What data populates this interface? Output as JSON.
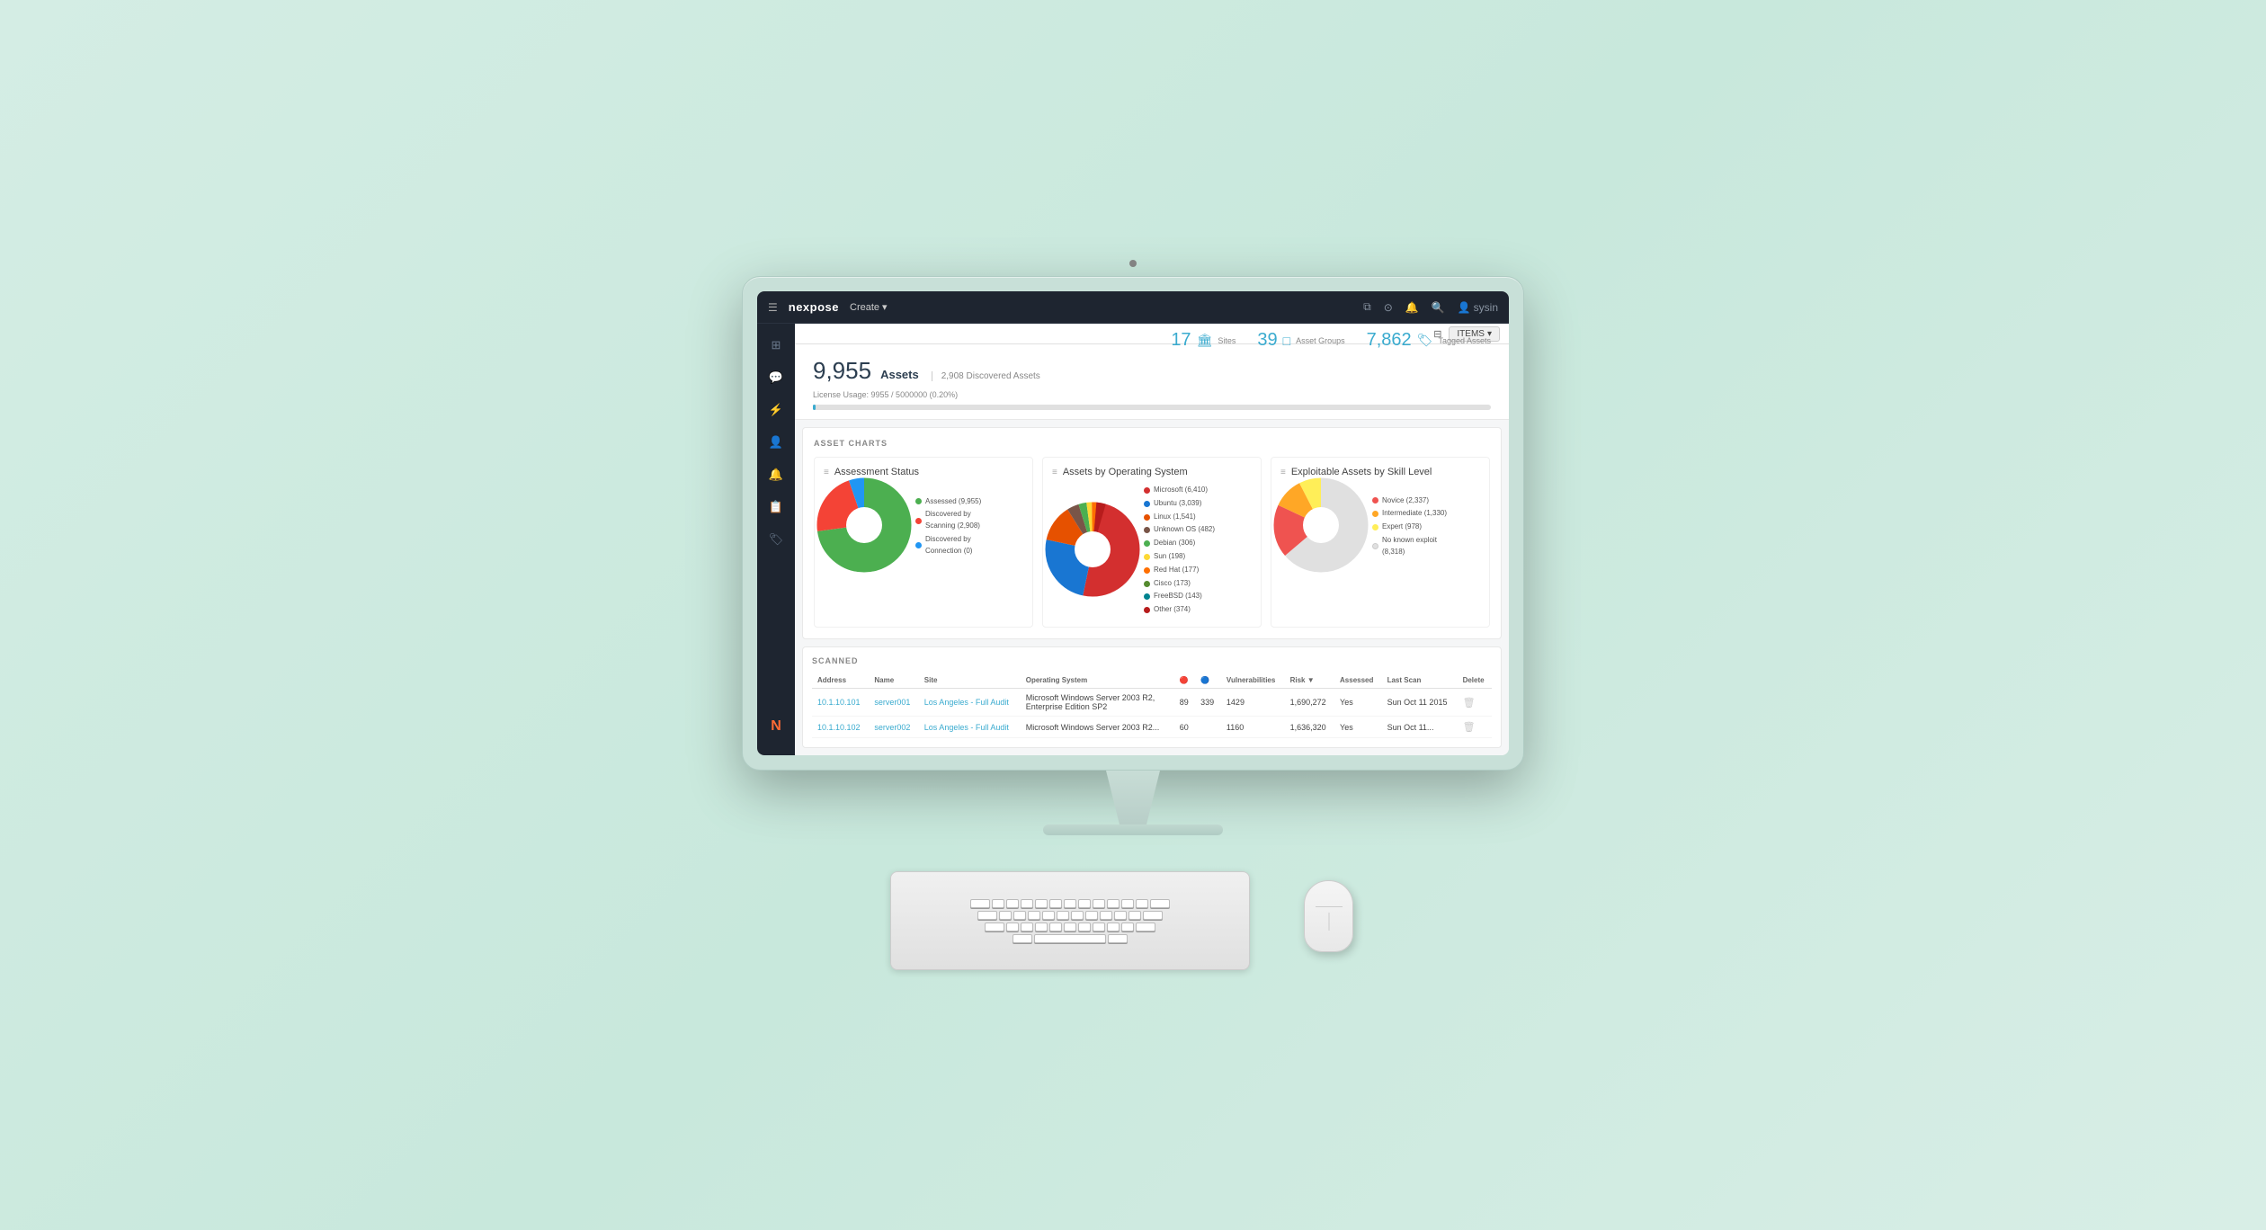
{
  "app": {
    "name": "nexpose",
    "create_label": "Create",
    "user": "sysin"
  },
  "toolbar": {
    "items_label": "ITEMS"
  },
  "assets": {
    "count": "9,955",
    "label": "Assets",
    "discovered": "2,908 Discovered Assets",
    "license_usage": "License Usage: 9955 / 5000000 (0.20%)",
    "sites_count": "17",
    "sites_label": "Sites",
    "asset_groups_count": "39",
    "asset_groups_label": "Asset Groups",
    "tagged_count": "7,862",
    "tagged_label": "Tagged Assets"
  },
  "charts": {
    "section_title": "ASSET CHARTS",
    "assessment": {
      "title": "Assessment Status",
      "legend": [
        {
          "label": "Assessed (9,955)",
          "color": "#4caf50"
        },
        {
          "label": "Discovered by Scanning (2,908)",
          "color": "#f44336"
        },
        {
          "label": "Discovered by Connection (0)",
          "color": "#2196f3"
        }
      ]
    },
    "operating_system": {
      "title": "Assets by Operating System",
      "legend": [
        {
          "label": "Microsoft (6,410)",
          "color": "#d32f2f"
        },
        {
          "label": "Ubuntu (3,039)",
          "color": "#1565c0"
        },
        {
          "label": "Linux (1,541)",
          "color": "#e65100"
        },
        {
          "label": "Unknown OS (482)",
          "color": "#6a1520"
        },
        {
          "label": "Debian (306)",
          "color": "#4caf50"
        },
        {
          "label": "Sun (198)",
          "color": "#ffd600"
        },
        {
          "label": "Red Hat (177)",
          "color": "#ff6f00"
        },
        {
          "label": "Cisco (173)",
          "color": "#558b2f"
        },
        {
          "label": "FreeBSD (143)",
          "color": "#00838f"
        },
        {
          "label": "Other (374)",
          "color": "#b71c1c"
        }
      ]
    },
    "exploitable": {
      "title": "Exploitable Assets by Skill Level",
      "legend": [
        {
          "label": "Novice (2,337)",
          "color": "#ef5350"
        },
        {
          "label": "Intermediate (1,330)",
          "color": "#ffa726"
        },
        {
          "label": "Expert (978)",
          "color": "#ffee58"
        },
        {
          "label": "No known exploit (8,318)",
          "color": "#e0e0e0"
        }
      ]
    }
  },
  "table": {
    "section_title": "SCANNED",
    "columns": [
      "Address",
      "Name",
      "Site",
      "Operating System",
      "",
      "",
      "Vulnerabilities",
      "Risk",
      "Assessed",
      "Last Scan",
      "Delete"
    ],
    "rows": [
      {
        "address": "10.1.10.101",
        "name": "server001",
        "site": "Los Angeles - Full Audit",
        "os": "Microsoft Windows Server 2003 R2, Enterprise Edition SP2",
        "v1": "89",
        "v2": "339",
        "vuln": "1429",
        "risk": "1,690,272",
        "assessed": "Yes",
        "last_scan": "Sun Oct 11 2015",
        "delete": "🗑"
      },
      {
        "address": "10.1.10.102",
        "name": "server002",
        "site": "Los Angeles - Full Audit",
        "os": "Microsoft Windows Server 2003 R2...",
        "v1": "60",
        "v2": "",
        "vuln": "1160",
        "risk": "1,636,320",
        "assessed": "Yes",
        "last_scan": "Sun Oct 11...",
        "delete": "🗑"
      }
    ]
  },
  "sidebar": {
    "icons": [
      {
        "name": "home-icon",
        "symbol": "⊞"
      },
      {
        "name": "message-icon",
        "symbol": "💬"
      },
      {
        "name": "vulnerability-icon",
        "symbol": "⚡"
      },
      {
        "name": "asset-icon",
        "symbol": "👤"
      },
      {
        "name": "alert-icon",
        "symbol": "🔔"
      },
      {
        "name": "report-icon",
        "symbol": "📋"
      },
      {
        "name": "tag-icon",
        "symbol": "🏷"
      },
      {
        "name": "nexpose-logo-icon",
        "symbol": "N"
      }
    ]
  }
}
